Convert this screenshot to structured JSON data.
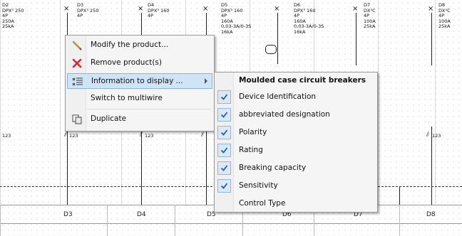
{
  "schematic": {
    "columns": [
      {
        "annotation": "D2\nDPX³ 250\n4P\n250A\n25kA",
        "number": "123",
        "label": ""
      },
      {
        "annotation": "D3\nDPX³ 250\n4P",
        "number": "123",
        "label": "D3"
      },
      {
        "annotation": "D4\nDPX³ 160\n4P",
        "number": "123",
        "label": "D4"
      },
      {
        "annotation": "D5\nDPX³ 160\n4P\n160A\n0,03-3A/0-3S\n16kA",
        "number": "",
        "label": "D5"
      },
      {
        "annotation": "D6\nDPX³ 160\n4P\n160A\n0,03-3A/0-3S\n16kA",
        "number": "",
        "label": "D6"
      },
      {
        "annotation": "D7\nDX³C\n4P\n100A\n25kA",
        "number": "",
        "label": "D7"
      },
      {
        "annotation": "D8\nDX³C\n4P\n100A\n25kA",
        "number": "123",
        "label": "D8"
      }
    ]
  },
  "context_menu": {
    "items": [
      {
        "label": "Modify the product...",
        "icon": "pencil-icon"
      },
      {
        "label": "Remove product(s)",
        "icon": "red-x-icon"
      },
      {
        "label": "Information to display ...",
        "icon": "list-settings-icon",
        "has_submenu": true,
        "highlighted": true
      },
      {
        "label": "Switch to multiwire",
        "icon": ""
      },
      {
        "label": "Duplicate",
        "icon": "duplicate-icon"
      }
    ]
  },
  "submenu": {
    "header": "Moulded case circuit breakers",
    "items": [
      {
        "label": "Device Identification",
        "checked": true
      },
      {
        "label": "abbreviated designation",
        "checked": true
      },
      {
        "label": "Polarity",
        "checked": true
      },
      {
        "label": "Rating",
        "checked": true
      },
      {
        "label": "Breaking capacity",
        "checked": true
      },
      {
        "label": "Sensitivity",
        "checked": true
      },
      {
        "label": "Control Type",
        "checked": false
      }
    ]
  },
  "colors": {
    "accent": "#cfe4f7",
    "check": "#1f5fb0",
    "remove": "#d9262c"
  }
}
